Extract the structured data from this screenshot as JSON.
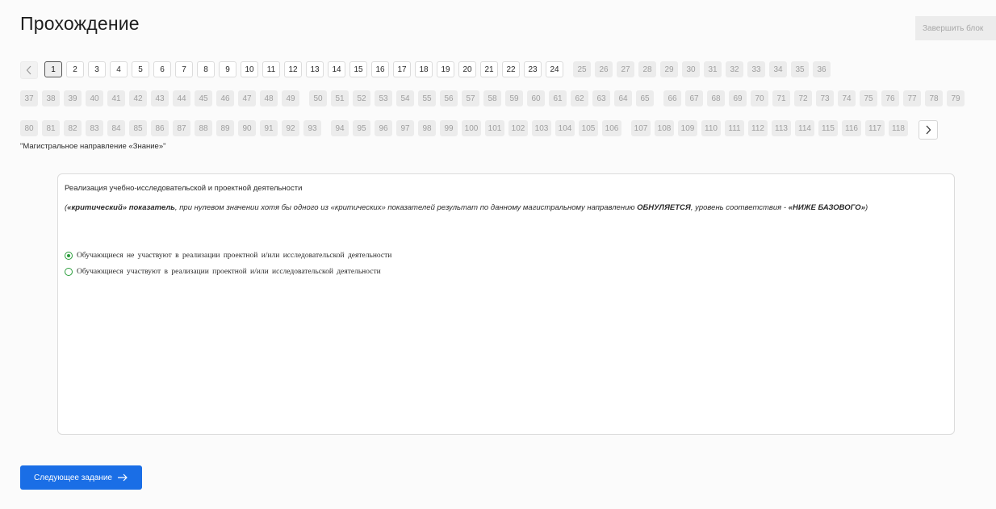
{
  "header": {
    "title": "Прохождение",
    "finish_label": "Завершить блок"
  },
  "pager": {
    "prev_icon": "chevron-left-icon",
    "next_icon": "chevron-right-icon",
    "current": 1,
    "done_through": 24,
    "rows": [
      {
        "pages": [
          "1",
          "2",
          "3",
          "4",
          "5",
          "6",
          "7",
          "8",
          "9",
          "10",
          "11",
          "12",
          "13",
          "14",
          "15",
          "16",
          "17",
          "18",
          "19",
          "20",
          "21",
          "22",
          "23",
          "24",
          "25",
          "26",
          "27",
          "28",
          "29",
          "30",
          "31",
          "32",
          "33",
          "34",
          "35",
          "36"
        ]
      },
      {
        "pages": [
          "37",
          "38",
          "39",
          "40",
          "41",
          "42",
          "43",
          "44",
          "45",
          "46",
          "47",
          "48",
          "49",
          "50",
          "51",
          "52",
          "53",
          "54",
          "55",
          "56",
          "57",
          "58",
          "59",
          "60",
          "61",
          "62",
          "63",
          "64",
          "65",
          "66",
          "67",
          "68",
          "69",
          "70",
          "71",
          "72",
          "73",
          "74",
          "75",
          "76",
          "77",
          "78",
          "79"
        ]
      },
      {
        "pages": [
          "80",
          "81",
          "82",
          "83",
          "84",
          "85",
          "86",
          "87",
          "88",
          "89",
          "90",
          "91",
          "92",
          "93",
          "94",
          "95",
          "96",
          "97",
          "98",
          "99",
          "100",
          "101",
          "102",
          "103",
          "104",
          "105",
          "106",
          "107",
          "108",
          "109",
          "110",
          "111",
          "112",
          "113",
          "114",
          "115",
          "116",
          "117",
          "118"
        ]
      }
    ]
  },
  "section_label": "\"Магистральное направление «Знание»\"",
  "question": {
    "title": "Реализация учебно-исследовательской и проектной деятельности",
    "note_open": "(",
    "note_bold1": "«критический» показатель",
    "note_mid": ", при нулевом значении хотя бы одного из «критических» показателей результат по данному магистральному направлению ",
    "note_bold2": "ОБНУЛЯЕТСЯ",
    "note_mid2": ", уровень соответствия - ",
    "note_bold3": "«НИЖЕ БАЗОВОГО»",
    "note_close": ")",
    "options": [
      {
        "label": "Обучающиеся не участвуют в реализации проектной и/или исследовательской деятельности",
        "selected": true
      },
      {
        "label": "Обучающиеся участвуют в реализации проектной и/или исследовательской деятельности",
        "selected": false
      }
    ]
  },
  "footer": {
    "next_label": "Следующее задание",
    "next_icon": "arrow-right-icon"
  },
  "colors": {
    "accent": "#1a6ee6",
    "radio": "#2a9d3b"
  }
}
